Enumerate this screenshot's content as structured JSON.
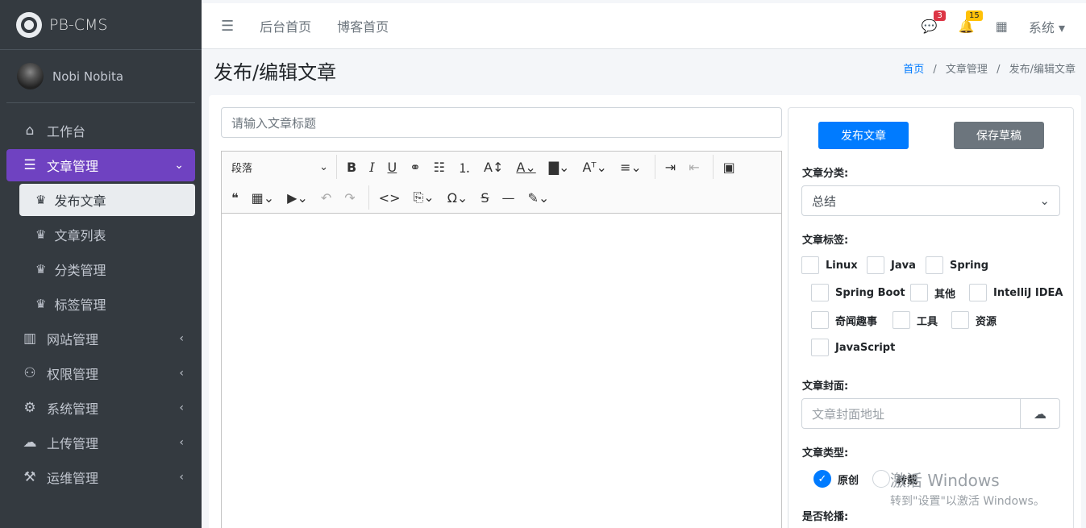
{
  "brand": {
    "name": "PB-CMS"
  },
  "user": {
    "name": "Nobi Nobita"
  },
  "sidebar": {
    "items": [
      {
        "label": "工作台",
        "icon": "home-icon"
      },
      {
        "label": "文章管理",
        "icon": "list-icon"
      },
      {
        "label": "网站管理",
        "icon": "columns-icon"
      },
      {
        "label": "权限管理",
        "icon": "users-cog-icon"
      },
      {
        "label": "系统管理",
        "icon": "gear-icon"
      },
      {
        "label": "上传管理",
        "icon": "cloud-upload-icon"
      },
      {
        "label": "运维管理",
        "icon": "people-carry-icon"
      }
    ],
    "subitems": [
      {
        "label": "发布文章",
        "icon": "chess-queen-icon"
      },
      {
        "label": "文章列表",
        "icon": "chess-queen-icon"
      },
      {
        "label": "分类管理",
        "icon": "chess-queen-icon"
      },
      {
        "label": "标签管理",
        "icon": "chess-queen-icon"
      }
    ]
  },
  "topbar": {
    "links": [
      "后台首页",
      "博客首页"
    ],
    "messages_badge": "3",
    "notifications_badge": "15",
    "system_label": "系统"
  },
  "page": {
    "title": "发布/编辑文章",
    "breadcrumb": [
      "首页",
      "文章管理",
      "发布/编辑文章"
    ]
  },
  "editor": {
    "title_placeholder": "请输入文章标题",
    "paragraph_label": "段落"
  },
  "panel": {
    "publish_label": "发布文章",
    "draft_label": "保存草稿",
    "category_label": "文章分类:",
    "category_value": "总结",
    "tags_label": "文章标签:",
    "tags": [
      "Linux",
      "Java",
      "Spring",
      "Spring Boot",
      "其他",
      "IntelliJ IDEA",
      "奇闻趣事",
      "工具",
      "资源",
      "JavaScript"
    ],
    "cover_label": "文章封面:",
    "cover_placeholder": "文章封面地址",
    "type_label": "文章类型:",
    "type_options": [
      "原创",
      "转载"
    ],
    "carousel_label": "是否轮播:"
  },
  "watermark": {
    "line1": "激活 Windows",
    "line2": "转到\"设置\"以激活 Windows。"
  },
  "colors": {
    "sidebar_bg": "#343a40",
    "active_nav": "#6f42c1",
    "primary": "#007bff",
    "secondary": "#6c757d"
  }
}
